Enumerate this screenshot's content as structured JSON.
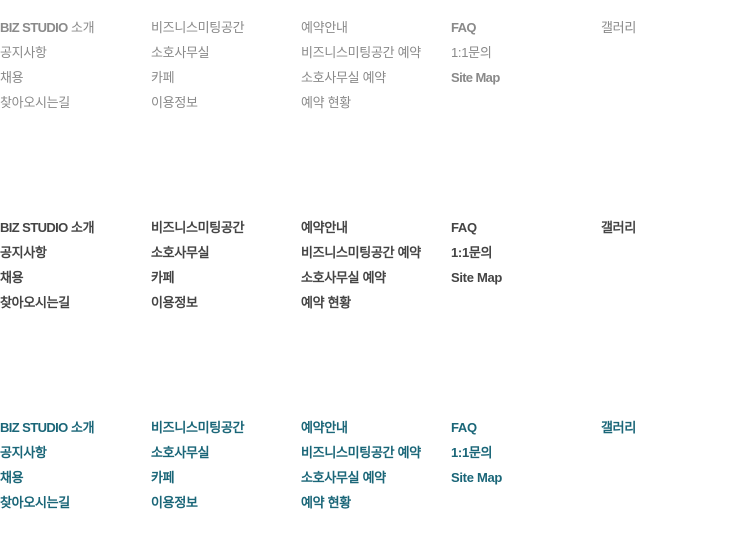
{
  "menu": {
    "brand_name": "BIZ STUDIO",
    "columns": [
      [
        "소개",
        "공지사항",
        "채용",
        "찾아오시는길"
      ],
      [
        "비즈니스미팅공간",
        "소호사무실",
        "카페",
        "이용정보"
      ],
      [
        "예약안내",
        "비즈니스미팅공간 예약",
        "소호사무실 예약",
        "예약 현황"
      ],
      [
        "FAQ",
        "1:1문의",
        "Site Map"
      ],
      [
        "갤러리"
      ]
    ]
  },
  "colors": {
    "normal_text": "#8a8a8a",
    "bold_text": "#444444",
    "accent_text": "#1a6678"
  }
}
